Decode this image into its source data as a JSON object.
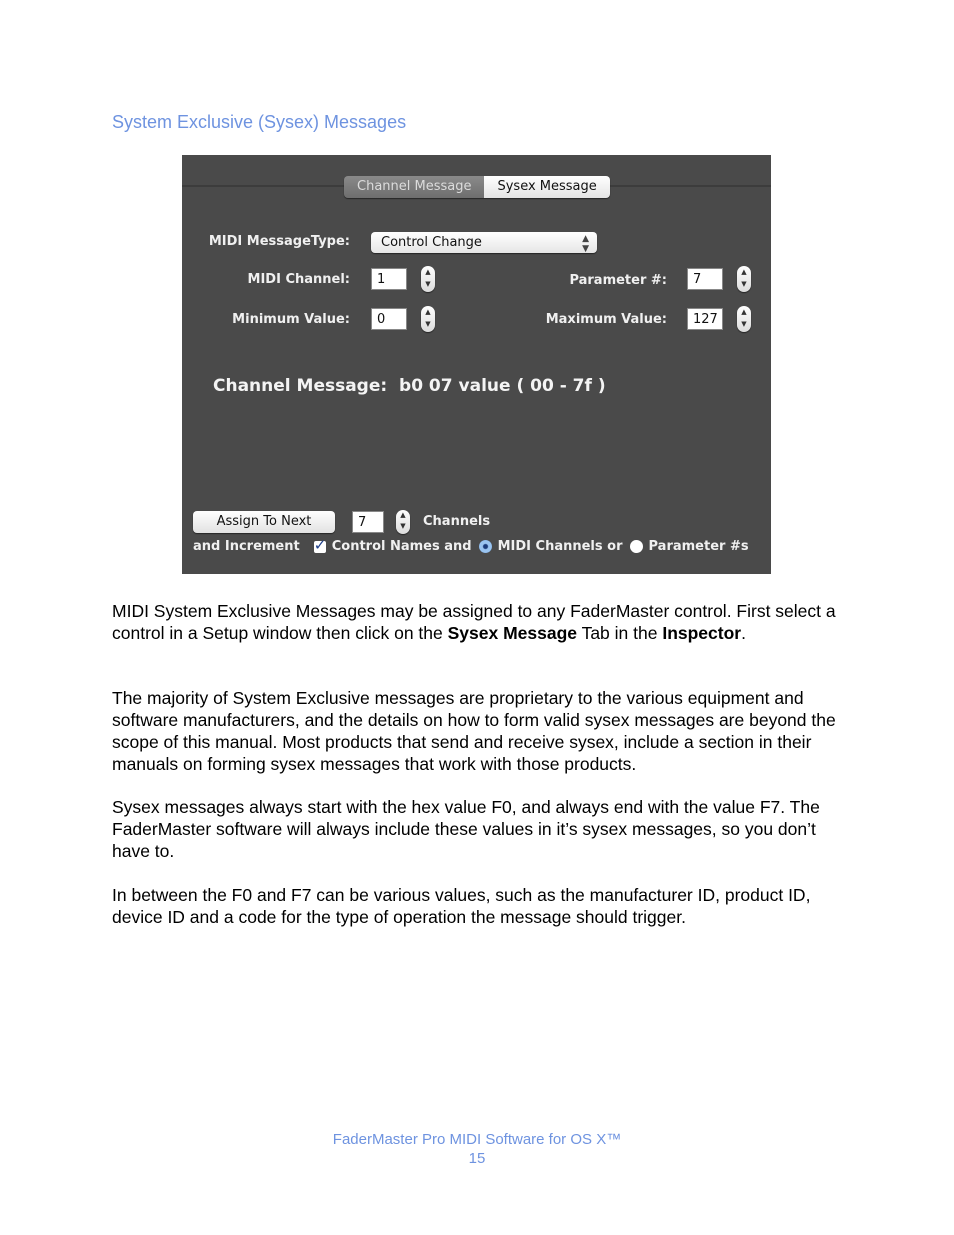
{
  "section_title": "System Exclusive (Sysex) Messages",
  "inspector": {
    "tabs": [
      {
        "label": "Channel Message",
        "active": false
      },
      {
        "label": "Sysex Message",
        "active": true
      }
    ],
    "message_type_label": "MIDI MessageType:",
    "message_type_value": "Control Change",
    "midi_channel_label": "MIDI Channel:",
    "midi_channel_value": "1",
    "parameter_label": "Parameter #:",
    "parameter_value": "7",
    "minimum_label": "Minimum Value:",
    "minimum_value": "0",
    "maximum_label": "Maximum Value:",
    "maximum_value": "127",
    "channel_message_text": "Channel Message:  b0 07 value ( 00 - 7f )",
    "assign_button": "Assign To Next",
    "assign_count": "7",
    "channels_label": "Channels",
    "and_increment_label": "and Increment",
    "control_names_label": "Control Names and",
    "control_names_checked": true,
    "midi_channels_label": "MIDI Channels or",
    "midi_channels_selected": true,
    "parameters_label": "Parameter #s",
    "parameters_selected": false
  },
  "paragraphs": {
    "p1_a": "MIDI System Exclusive Messages may be assigned to any FaderMaster control. First select a control in a Setup window then click on the ",
    "p1_b": "Sysex Message",
    "p1_c": " Tab in the ",
    "p1_d": "Inspector",
    "p1_e": ".",
    "p2": "The majority of System Exclusive messages are proprietary to the various equipment and software manufacturers, and the details on how to form valid sysex messages are beyond the scope of this manual. Most products that send and receive sysex, include a section in their manuals on forming sysex messages that work with those products.",
    "p3": "Sysex messages always start with the hex value F0, and always end with the value F7. The FaderMaster software will always include these values in it’s sysex messages, so you don’t have to.",
    "p4": "In between the F0 and F7 can be various values, such as the manufacturer ID, product ID, device ID and a code for the type of operation the message should trigger."
  },
  "footer": {
    "title": "FaderMaster Pro MIDI Software for OS X™",
    "page_number": "15"
  }
}
